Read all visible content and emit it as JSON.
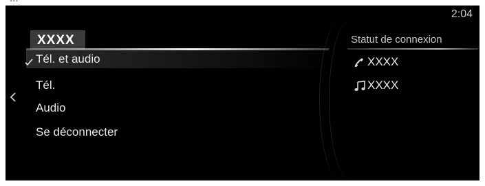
{
  "header_cut": "...",
  "clock": {
    "time": "2:04"
  },
  "menu": {
    "header": "XXXX",
    "items": [
      {
        "label": "Tél. et audio",
        "checked": true
      },
      {
        "label": "Tél.",
        "checked": false
      },
      {
        "label": "Audio",
        "checked": false
      },
      {
        "label": "Se déconnecter",
        "checked": false
      }
    ]
  },
  "status": {
    "title": "Statut de connexion",
    "rows": [
      {
        "icon": "phone-icon",
        "label": "XXXX"
      },
      {
        "icon": "music-note-icon",
        "label": "XXXX"
      }
    ]
  },
  "colors": {
    "background": "#000000",
    "text": "#e8e8e8",
    "header_box": "#3b3b3b"
  }
}
